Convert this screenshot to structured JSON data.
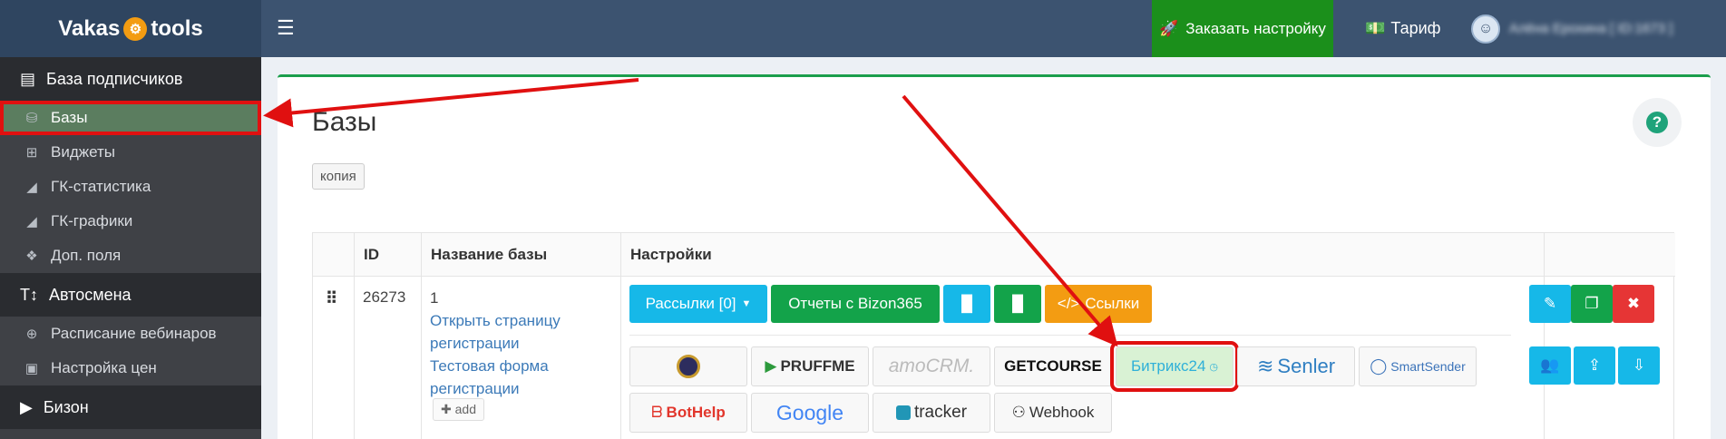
{
  "header": {
    "logo": {
      "left": "Vakas",
      "right": "tools"
    },
    "menu_icon": "hamburger-icon",
    "order_button": "Заказать настройку",
    "tariff": "Тариф",
    "user_name": "Алёна Ерохина [ ID:1673 ]"
  },
  "sidebar": {
    "sections": [
      {
        "title": "База подписчиков",
        "items": [
          "Базы",
          "Виджеты",
          "ГК-статистика",
          "ГК-графики",
          "Доп. поля"
        ]
      },
      {
        "title": "Автосмена",
        "items": [
          "Расписание вебинаров",
          "Настройка цен"
        ]
      },
      {
        "title": "Бизон",
        "items": []
      }
    ]
  },
  "main": {
    "title": "Базы",
    "copy_tag": "копия",
    "table": {
      "headers": [
        "ID",
        "Название базы",
        "Настройки"
      ],
      "row": {
        "id": "26273",
        "name": "1",
        "links": [
          "Открыть страницу регистрации",
          "Тестовая форма регистрации"
        ],
        "add_label": "add",
        "buttons": {
          "mailings": "Рассылки [0]",
          "reports": "Отчеты с Bizon365",
          "links": "Ссылки"
        },
        "integrations": [
          "PRUFFME",
          "amoCRM.",
          "GETCOURSE",
          "Битрикс24",
          "Senler",
          "SmartSender",
          "BotHelp",
          "Google",
          "tracker",
          "Webhook"
        ]
      }
    }
  },
  "colors": {
    "topbar": "#3c5370",
    "order_button": "#1b8f1b",
    "accent_cyan": "#16b8e8",
    "accent_green": "#13a34a",
    "accent_orange": "#f39c12",
    "danger": "#e63535",
    "annotation_red": "#e01010"
  }
}
